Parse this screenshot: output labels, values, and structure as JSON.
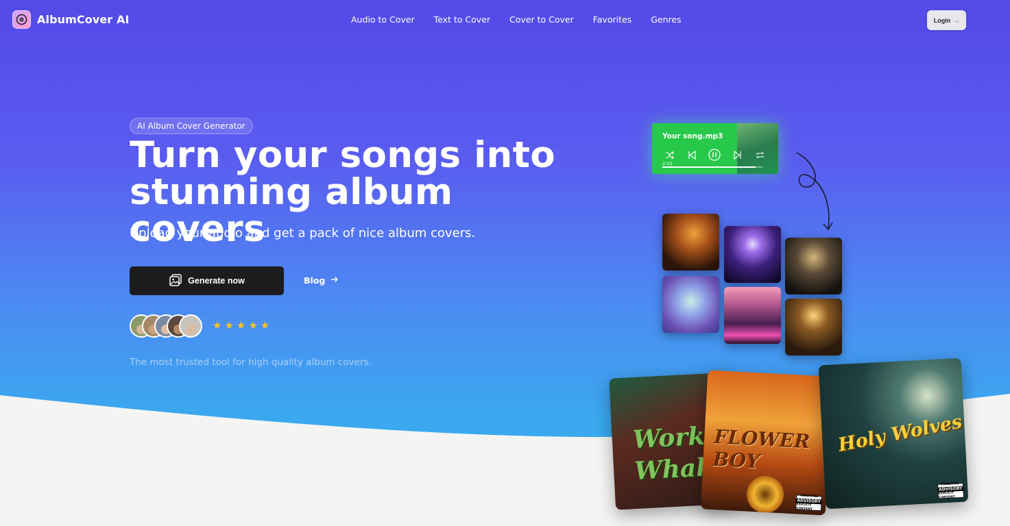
{
  "app": {
    "name": "AlbumCover AI"
  },
  "nav": {
    "links": [
      "Audio to Cover",
      "Text to Cover",
      "Cover to Cover",
      "Favorites",
      "Genres"
    ],
    "login_label": "Login",
    "login_icon": "arrow-right-icon"
  },
  "hero": {
    "badge": "AI Album Cover Generator",
    "headline": "Turn your songs into stunning album covers",
    "subhead": "Upload your audio and get a pack of nice album covers.",
    "primary_cta": "Generate now",
    "primary_cta_icon": "image-icon",
    "secondary_cta": "Blog",
    "secondary_cta_icon": "arrow-right-icon",
    "rating_stars": 5,
    "avatar_count": 5,
    "trust_text": "The most trusted tool for high quality album covers."
  },
  "player": {
    "title": "Your song.mp3",
    "time": "2:10",
    "progress": 0.93,
    "controls": [
      "shuffle-icon",
      "previous-icon",
      "pause-icon",
      "next-icon",
      "repeat-icon"
    ]
  },
  "covers": {
    "cover1_text": "Work Whak",
    "cover2_text": "FLOWER BOY",
    "cover3_text": "Holy Wolves",
    "advisory_title": "PARENTAL",
    "advisory_main": "ADVISORY",
    "advisory_sub": "EXPLICIT CONTENT"
  },
  "colors": {
    "hero_top": "#5349e8",
    "hero_bottom": "#3aa9ef",
    "player_green": "#28c94a",
    "star": "#f7c427",
    "cta_dark": "#1c1c1f"
  }
}
